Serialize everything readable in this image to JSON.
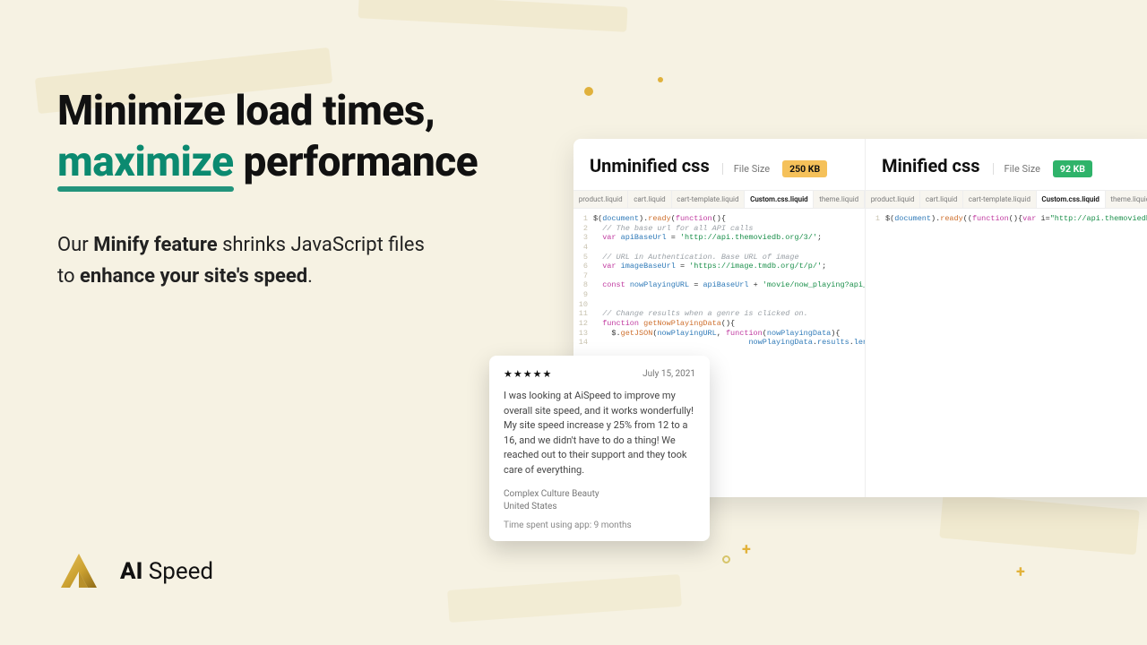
{
  "hero": {
    "line1": "Minimize load times,",
    "accent": "maximize",
    "line2_rest": " performance",
    "sub_pre": "Our ",
    "sub_b1": "Minify feature",
    "sub_mid": " shrinks JavaScript files to ",
    "sub_b2": "enhance your site's speed",
    "sub_post": "."
  },
  "panel": {
    "left": {
      "title": "Unminified css",
      "fs_label": "File Size",
      "fs_value": "250 KB",
      "tabs": [
        "product.liquid",
        "cart.liquid",
        "cart-template.liquid",
        "Custom.css.liquid",
        "theme.liquid"
      ],
      "active_tab": 3,
      "lines": [
        {
          "n": "1",
          "html": "$(<span class=tok-id>document</span>).<span class=tok-fn>ready</span>(<span class=tok-kw>function</span>(){"
        },
        {
          "n": "2",
          "html": "  <span class=tok-cmt>// The base url for all API calls</span>"
        },
        {
          "n": "3",
          "html": "  <span class=tok-kw>var</span> <span class=tok-id>apiBaseUrl</span> = <span class=tok-str>'http://api.themoviedb.org/3/'</span>;"
        },
        {
          "n": "4",
          "html": ""
        },
        {
          "n": "5",
          "html": "  <span class=tok-cmt>// URL in Authentication. Base URL of image</span>"
        },
        {
          "n": "6",
          "html": "  <span class=tok-kw>var</span> <span class=tok-id>imageBaseUrl</span> = <span class=tok-str>'https://image.tmdb.org/t/p/'</span>;"
        },
        {
          "n": "7",
          "html": ""
        },
        {
          "n": "8",
          "html": "  <span class=tok-kw>const</span> <span class=tok-id>nowPlayingURL</span> = <span class=tok-id>apiBaseUrl</span> + <span class=tok-str>'movie/now_playing?api_key='</span> + <span class=tok-id>apiKey</span>;"
        },
        {
          "n": "9",
          "html": ""
        },
        {
          "n": "10",
          "html": ""
        },
        {
          "n": "11",
          "html": "  <span class=tok-cmt>// Change results when a genre is clicked on.</span>"
        },
        {
          "n": "12",
          "html": "  <span class=tok-kw>function</span> <span class=tok-fn>getNowPlayingData</span>(){"
        },
        {
          "n": "13",
          "html": "    $.<span class=tok-fn>getJSON</span>(<span class=tok-id>nowPlayingURL</span>, <span class=tok-kw>function</span>(<span class=tok-id>nowPlayingData</span>){"
        },
        {
          "n": "14",
          "html": "                                  <span class=tok-id>nowPlayingData</span>.<span class=tok-id>results</span>.<span class=tok-id>length</span>"
        }
      ]
    },
    "right": {
      "title": "Minified css",
      "fs_label": "File Size",
      "fs_value": "92 KB",
      "tabs": [
        "product.liquid",
        "cart.liquid",
        "cart-template.liquid",
        "Custom.css.liquid",
        "theme.liquid"
      ],
      "active_tab": 3,
      "mini_html": "$(<span class=tok-id>document</span>).<span class=tok-fn>ready</span>((<span class=tok-kw>function</span>(){<span class=tok-kw>var</span> i=<span class=tok-str>\"http://api.themoviedb.org/3/\"</span>,e=<span class=tok-str>\"https://image.tmdb.org/t/p/\"</span>;<span class=tok-kw>const</span> a=i+<span class=tok-str>\"movie/now_playing?api_key=\"</span>+apiKey;<span class=tok-kw>function</span> <span class=tok-fn>l</span>(){$.<span class=tok-fn>getJSON</span>(a,(<span class=tok-kw>function</span>(a){<span class=tok-kw>for</span>(<span class=tok-kw>let</span> s=<span class=tok-num>0</span>;s&lt;a.results.length;s++){<span class=tok-kw>var</span> l=a.results[s].id,t=i+<span class=tok-str>\"movie/\"</span>+l+<span class=tok-str>\"/videos?api_key=\"</span>+apiKey;$.<span class=tok-fn>getJSON</span>(t,(<span class=tok-kw>function</span>(i){<span class=tok-kw>var</span> l=e+<span class=tok-str>\"w300\"</span>+a.results[s].poster_path,t=a.results[s].original_title,o=a.results[s].release_date,r=a.results[s].overview,d=a.results[s].vote_average,n=<span class=tok-str>\"https://www.youtube.com/watch?v=\"</span>+i.results[<span class=tok-num>0</span>].key,c=<span class=tok-str>\"\"</span>;c+='&lt;div class=\"col-sm-3 eachMovie\"&gt;',c+='&lt;button type=\"button\" class=\"btnModal\" data-toggle=\"modal\" data-target=\"#exampleModal'+s+'\" data-whatever=\"@'+s+'\"&gt;&lt;img src=\"'+l+'\"&gt;&lt;/button&gt;',c+='&lt;div class=\"modal fade\" id=\"exampleModal'+s+'\" tabindex=\"-1\" role=\"dialog\" aria-labelledby=\"exampleModalLabel\" aria-hidden=\"true\"&gt;',c+='&lt;div class=\"modal-dialog\""
    }
  },
  "review": {
    "stars": "★★★★★",
    "date": "July 15, 2021",
    "body": "I was looking at AiSpeed to improve my overall site speed, and it works wonderfully! My site speed increase y 25% from 12 to a 16, and we didn't have to do a thing! We reached out to their support and they took care of everything.",
    "company": "Complex Culture Beauty",
    "country": "United States",
    "time": "Time spent using app: 9 months"
  },
  "brand": {
    "bold": "AI",
    "rest": " Speed"
  }
}
